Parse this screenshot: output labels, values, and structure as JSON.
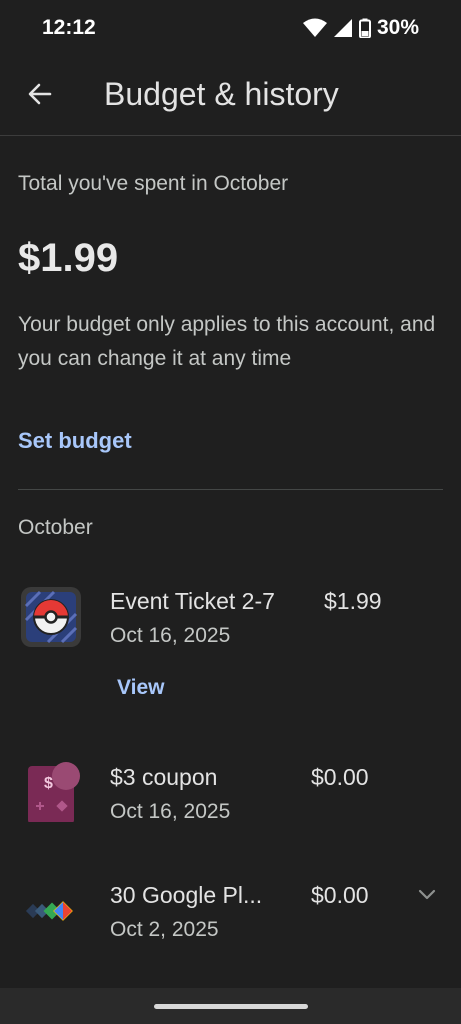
{
  "status_bar": {
    "time": "12:12",
    "battery": "30%",
    "icons": [
      "wifi-icon",
      "signal-icon",
      "battery-icon"
    ]
  },
  "app_bar": {
    "title": "Budget & history",
    "back_icon": "arrow-back-icon"
  },
  "summary": {
    "label": "Total you've spent in October",
    "amount": "$1.99",
    "note": "Your budget only applies to this account, and you can change it at any time",
    "set_budget_label": "Set budget"
  },
  "history": {
    "section_label": "October",
    "items": [
      {
        "title": "Event Ticket 2-7",
        "date": "Oct 16, 2025",
        "price": "$1.99",
        "action": "View",
        "icon": "pokemon-go-app-icon"
      },
      {
        "title": "$3 coupon",
        "date": "Oct 16, 2025",
        "price": "$0.00",
        "icon": "coupon-icon",
        "icon_text": "$"
      },
      {
        "title": "30 Google Pl...",
        "date": "Oct 2, 2025",
        "price": "$0.00",
        "icon": "google-play-points-icon",
        "expand_icon": "chevron-down-icon"
      }
    ]
  },
  "colors": {
    "background": "#1f1f1f",
    "accent": "#a8c7fa",
    "text_primary": "#e3e3e3",
    "text_secondary": "#c4c7c5"
  }
}
